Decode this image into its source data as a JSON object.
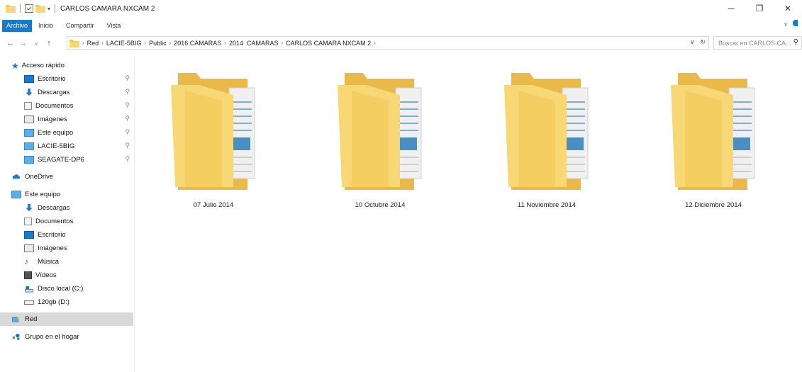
{
  "window": {
    "title": "CARLOS CAMARA NXCAM 2"
  },
  "ribbon": {
    "tabs": [
      "Archivo",
      "Inicio",
      "Compartir",
      "Vista"
    ]
  },
  "address": {
    "breadcrumbs": [
      "Red",
      "LACIE-5BIG",
      "Public",
      "2016 CÁMARAS",
      "2014  CAMARAS",
      "CARLOS CAMARA NXCAM 2"
    ]
  },
  "search": {
    "placeholder": "Buscar en CARLOS CA..."
  },
  "sidebar": {
    "quick_access": "Acceso rápido",
    "pinned": [
      {
        "label": "Escritorio",
        "icon": "desktop-icon"
      },
      {
        "label": "Descargas",
        "icon": "download-icon"
      },
      {
        "label": "Documentos",
        "icon": "documents-icon"
      },
      {
        "label": "Imágenes",
        "icon": "pictures-icon"
      },
      {
        "label": "Este equipo",
        "icon": "computer-icon"
      },
      {
        "label": "LACIE-5BIG",
        "icon": "network-drive-icon"
      },
      {
        "label": "SEAGATE-DP6",
        "icon": "network-drive-icon"
      }
    ],
    "onedrive": "OneDrive",
    "this_pc": "Este equipo",
    "pc_items": [
      {
        "label": "Descargas",
        "icon": "download-icon"
      },
      {
        "label": "Documentos",
        "icon": "documents-icon"
      },
      {
        "label": "Escritorio",
        "icon": "desktop-icon"
      },
      {
        "label": "Imágenes",
        "icon": "pictures-icon"
      },
      {
        "label": "Música",
        "icon": "music-icon"
      },
      {
        "label": "Vídeos",
        "icon": "videos-icon"
      },
      {
        "label": "Disco local (C:)",
        "icon": "local-disk-icon"
      },
      {
        "label": "120gb (D:)",
        "icon": "drive-icon"
      }
    ],
    "network": "Red",
    "homegroup": "Grupo en el hogar"
  },
  "folders": [
    {
      "name": "07 Julio 2014"
    },
    {
      "name": "10 Octubre 2014"
    },
    {
      "name": "11 Noviembre 2014"
    },
    {
      "name": "12 Diciembre 2014"
    }
  ],
  "colors": {
    "accent": "#1979ca",
    "folder": "#f8d775",
    "selected": "#d9d9d9"
  }
}
